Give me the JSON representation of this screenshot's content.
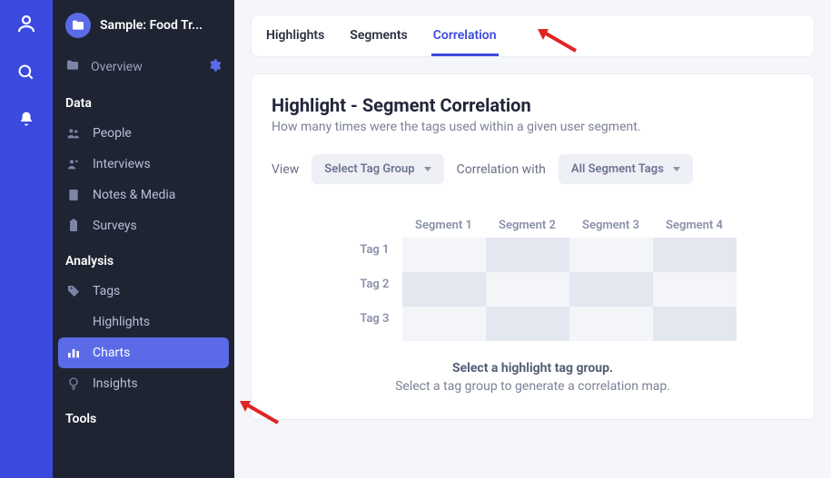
{
  "rail": {
    "icons": [
      "user-icon",
      "search-icon",
      "bell-icon"
    ]
  },
  "project": {
    "title": "Sample: Food Tr..."
  },
  "sidebar": {
    "overview_label": "Overview",
    "sections": {
      "data": {
        "header": "Data",
        "items": [
          {
            "label": "People",
            "icon": "people-icon"
          },
          {
            "label": "Interviews",
            "icon": "interviews-icon"
          },
          {
            "label": "Notes & Media",
            "icon": "notes-icon"
          },
          {
            "label": "Surveys",
            "icon": "surveys-icon"
          }
        ]
      },
      "analysis": {
        "header": "Analysis",
        "items": [
          {
            "label": "Tags",
            "icon": "tag-icon"
          },
          {
            "label": "Highlights",
            "icon": "highlights-icon"
          },
          {
            "label": "Charts",
            "icon": "chart-icon",
            "active": true
          },
          {
            "label": "Insights",
            "icon": "bulb-icon"
          }
        ]
      },
      "tools": {
        "header": "Tools"
      }
    }
  },
  "tabs": [
    {
      "label": "Highlights"
    },
    {
      "label": "Segments"
    },
    {
      "label": "Correlation",
      "active": true
    }
  ],
  "panel": {
    "title": "Highlight - Segment Correlation",
    "subtitle": "How many times were the tags used within a given user segment.",
    "view_label": "View",
    "tag_group_selector": "Select Tag Group",
    "corr_label": "Correlation with",
    "seg_selector": "All Segment Tags",
    "matrix": {
      "col_headers": [
        "Segment 1",
        "Segment 2",
        "Segment 3",
        "Segment 4"
      ],
      "row_headers": [
        "Tag 1",
        "Tag 2",
        "Tag 3"
      ]
    },
    "callout": {
      "line1": "Select a highlight tag group.",
      "line2": "Select a tag group to generate a correlation map."
    }
  }
}
